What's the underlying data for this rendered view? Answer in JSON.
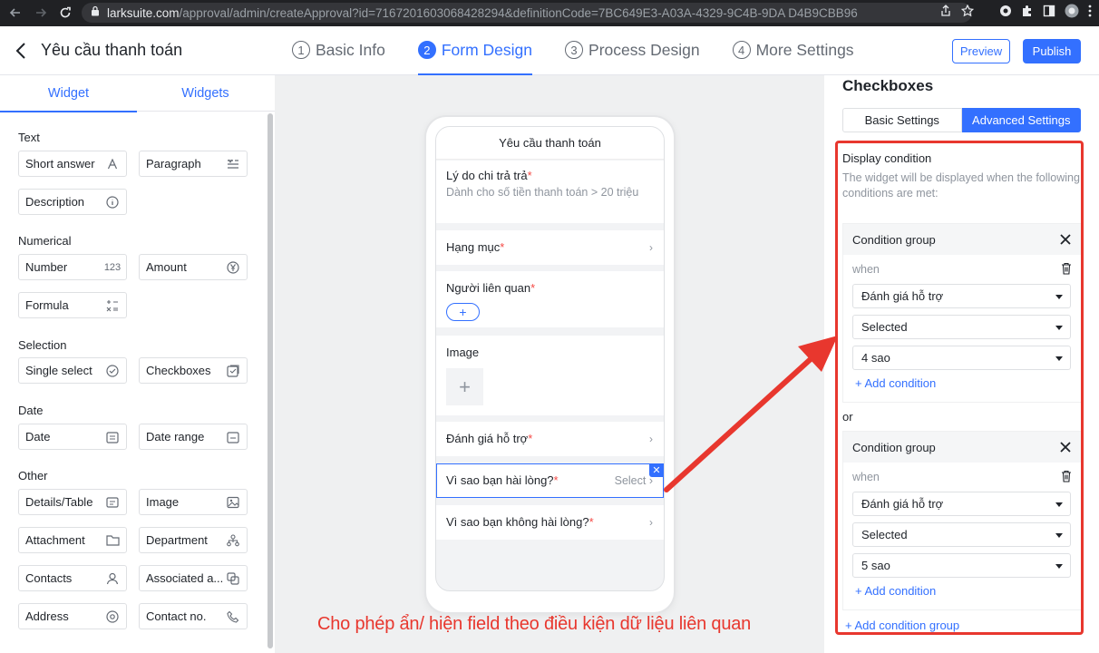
{
  "browser": {
    "url_host": "larksuite.com",
    "url_path": "/approval/admin/createApproval?id=7167201603068428294&definitionCode=7BC649E3-A03A-4329-9C4B-9DA D4B9CBB96"
  },
  "header": {
    "title": "Yêu cầu thanh toán",
    "steps": [
      {
        "num": "1",
        "label": "Basic Info",
        "active": false
      },
      {
        "num": "2",
        "label": "Form Design",
        "active": true
      },
      {
        "num": "3",
        "label": "Process Design",
        "active": false
      },
      {
        "num": "4",
        "label": "More Settings",
        "active": false
      }
    ],
    "preview_label": "Preview",
    "publish_label": "Publish"
  },
  "left": {
    "tabs": [
      "Widget",
      "Widgets"
    ],
    "sections": {
      "text": "Text",
      "numerical": "Numerical",
      "selection": "Selection",
      "date": "Date",
      "other": "Other"
    },
    "widgets": {
      "short_answer": "Short answer",
      "paragraph": "Paragraph",
      "description": "Description",
      "number": "Number",
      "number_icon": "123",
      "amount": "Amount",
      "formula": "Formula",
      "single_select": "Single select",
      "checkboxes": "Checkboxes",
      "date": "Date",
      "date_range": "Date range",
      "details_table": "Details/Table",
      "image": "Image",
      "attachment": "Attachment",
      "department": "Department",
      "contacts": "Contacts",
      "associated": "Associated a...",
      "address": "Address",
      "contact_no": "Contact no."
    }
  },
  "form": {
    "title": "Yêu cầu thanh toán",
    "fields": {
      "reason": {
        "label": "Lý do chi trả trả",
        "desc": "Dành cho số tiền thanh toán > 20 triệu"
      },
      "category": {
        "label": "Hạng mục"
      },
      "related": {
        "label": "Người liên quan"
      },
      "image": {
        "label": "Image"
      },
      "rating": {
        "label": "Đánh giá hỗ trợ"
      },
      "satisfied": {
        "label": "Vì sao bạn hài lòng?",
        "placeholder": "Select"
      },
      "unsatisfied": {
        "label": "Vì sao bạn không hài lòng?"
      }
    },
    "required_mark": "*",
    "caption": "Cho phép ẩn/ hiện field theo điều kiện dữ liệu liên quan"
  },
  "right": {
    "title": "Checkboxes",
    "tabs": {
      "basic": "Basic Settings",
      "advanced": "Advanced Settings"
    },
    "display_condition": "Display condition",
    "help": "The widget will be displayed when the following conditions are met:",
    "group_label": "Condition group",
    "when": "when",
    "or": "or",
    "add_condition": "+ Add condition",
    "add_group": "+ Add condition group",
    "groups": [
      {
        "field": "Đánh giá hỗ trợ",
        "op": "Selected",
        "value": "4 sao"
      },
      {
        "field": "Đánh giá hỗ trợ",
        "op": "Selected",
        "value": "5 sao"
      }
    ]
  },
  "colors": {
    "accent": "#3370ff",
    "annotation": "#e8372e"
  }
}
